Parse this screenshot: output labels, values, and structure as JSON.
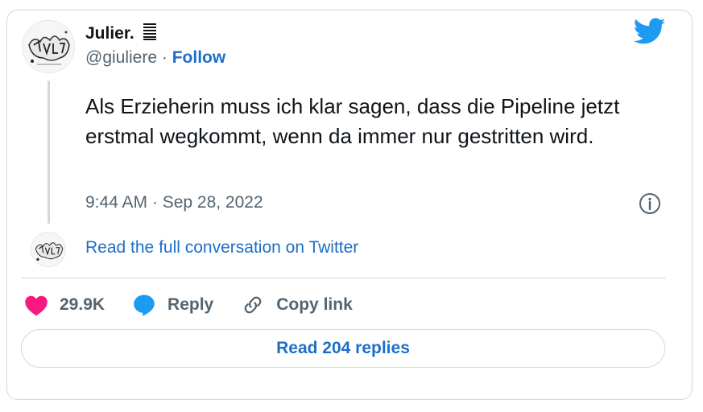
{
  "author": {
    "display_name": "Julier.",
    "name_icon": "stacked-lines-icon",
    "handle": "@giuliere",
    "separator": "·",
    "follow_label": "Follow",
    "avatar_icon": "graffiti-avatar-icon"
  },
  "tweet": {
    "text": "Als Erzieherin muss ich klar sagen, dass die Pipeline jetzt erstmal wegkommt, wenn da immer nur gestritten wird.",
    "timestamp": "9:44 AM · Sep 28, 2022"
  },
  "conversation": {
    "link_label": "Read the full conversation on Twitter"
  },
  "actions": {
    "likes_count": "29.9K",
    "reply_label": "Reply",
    "copy_link_label": "Copy link"
  },
  "replies_button_label": "Read 204 replies",
  "icons": {
    "brand": "twitter-bird-icon",
    "info": "info-icon",
    "like": "heart-icon",
    "reply": "speech-bubble-icon",
    "copy": "link-icon"
  },
  "colors": {
    "brand_blue": "#1d9bf0",
    "link_blue": "#1d6fc7",
    "heart_pink": "#f91880",
    "muted_text": "#536471",
    "border": "#cfd9de"
  }
}
